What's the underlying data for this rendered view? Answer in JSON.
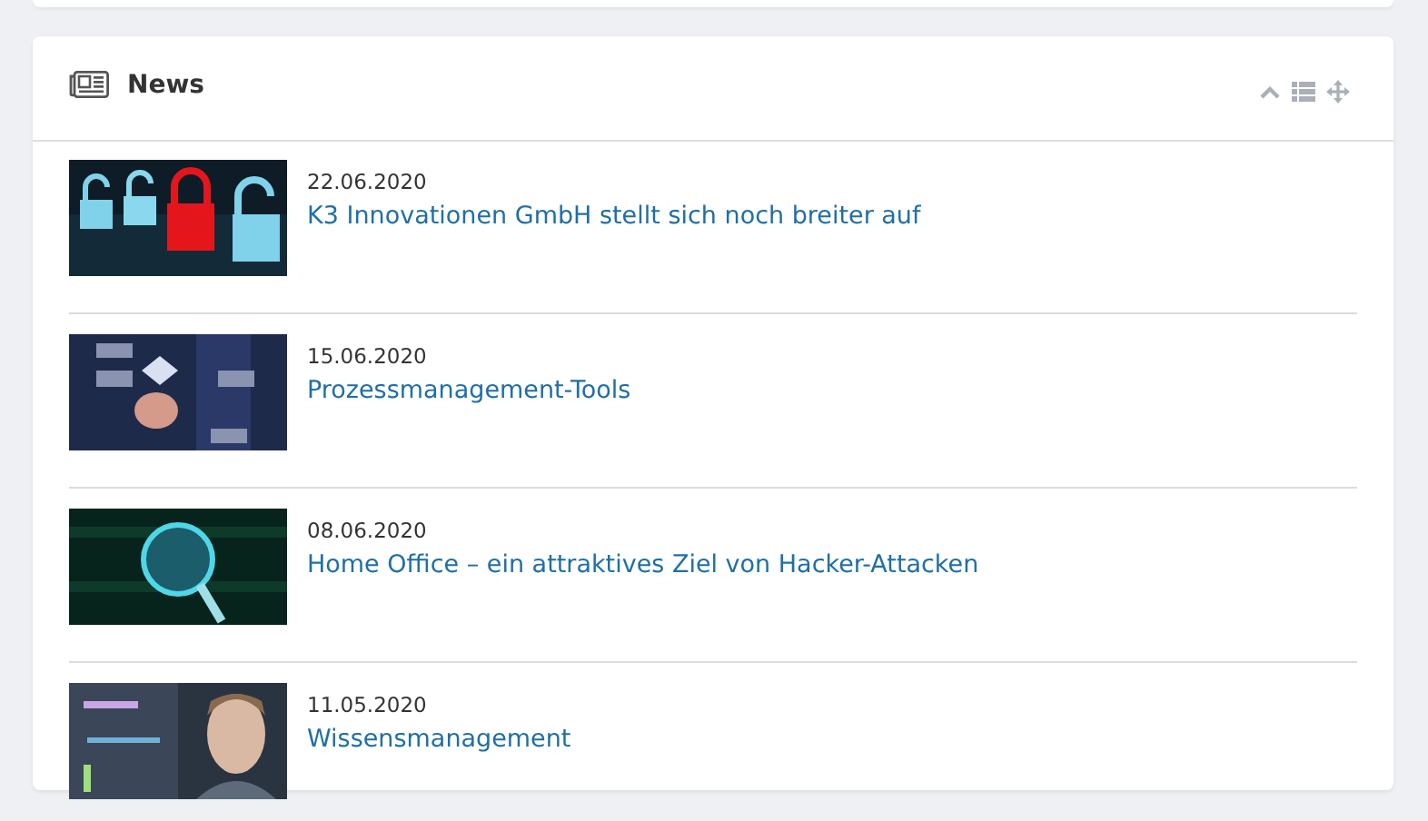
{
  "panel": {
    "title": "News"
  },
  "news": [
    {
      "date": "22.06.2020",
      "title": "K3 Innovationen GmbH stellt sich noch breiter auf"
    },
    {
      "date": "15.06.2020",
      "title": "Prozessmanagement-Tools"
    },
    {
      "date": "08.06.2020",
      "title": "Home Office – ein attraktives Ziel von Hacker-Attacken"
    },
    {
      "date": "11.05.2020",
      "title": "Wissensmanagement"
    }
  ]
}
